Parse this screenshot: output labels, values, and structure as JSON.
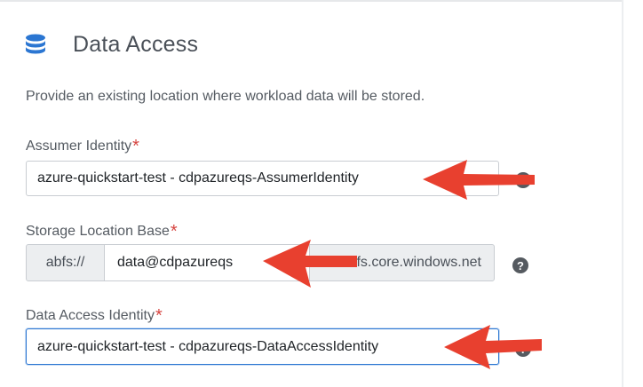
{
  "section": {
    "title": "Data Access",
    "icon": "database-icon",
    "description": "Provide an existing location where workload data will be stored."
  },
  "assumer_identity": {
    "label": "Assumer Identity",
    "required_mark": "*",
    "value": "azure-quickstart-test - cdpazureqs-AssumerIdentity"
  },
  "storage_location": {
    "label": "Storage Location Base",
    "required_mark": "*",
    "prefix": "abfs://",
    "value": "data@cdpazureqs",
    "suffix": ".dfs.core.windows.net"
  },
  "data_access_identity": {
    "label": "Data Access Identity",
    "required_mark": "*",
    "value": "azure-quickstart-test - cdpazureqs-DataAccessIdentity"
  },
  "help_glyph": "?",
  "colors": {
    "accent_blue": "#2b76d2",
    "required_red": "#d64541",
    "arrow_red": "#e8402f"
  }
}
